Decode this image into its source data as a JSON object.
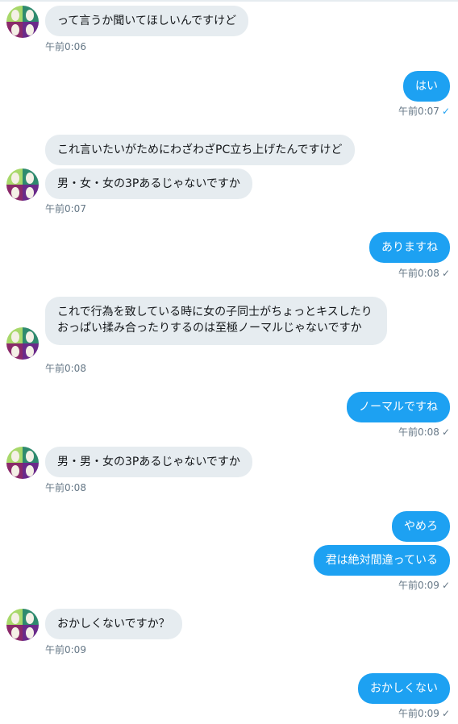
{
  "colors": {
    "incoming_bubble": "#e6ecf0",
    "outgoing_bubble": "#1da1f2",
    "timestamp": "#657786",
    "read_check": "#1da1f2"
  },
  "messages": [
    {
      "side": "in",
      "text": "って言うか聞いてほしいんですけど",
      "time": "午前0:06"
    },
    {
      "side": "out",
      "text": "はい",
      "time": "午前0:07",
      "check": "✓"
    },
    {
      "side": "in",
      "text": "これ言いたいがためにわざわざPC立ち上げたんですけど"
    },
    {
      "side": "in",
      "text": "男・女・女の3Pあるじゃないですか",
      "time": "午前0:07"
    },
    {
      "side": "out",
      "text": "ありますね",
      "time": "午前0:08",
      "check": "✓"
    },
    {
      "side": "in",
      "text": "これで行為を致している時に女の子同士がちょっとキスしたりおっぱい揉み合ったりするのは至極ノーマルじゃないですか",
      "time": "午前0:08"
    },
    {
      "side": "out",
      "text": "ノーマルですね",
      "time": "午前0:08",
      "check": "✓"
    },
    {
      "side": "in",
      "text": "男・男・女の3Pあるじゃないですか",
      "time": "午前0:08"
    },
    {
      "side": "out",
      "text": "やめろ"
    },
    {
      "side": "out",
      "text": "君は絶対間違っている",
      "time": "午前0:09",
      "check": "✓"
    },
    {
      "side": "in",
      "text": "おかしくないですか？",
      "time": "午前0:09"
    },
    {
      "side": "out",
      "text": "おかしくない",
      "time": "午前0:09",
      "check": "✓"
    }
  ]
}
